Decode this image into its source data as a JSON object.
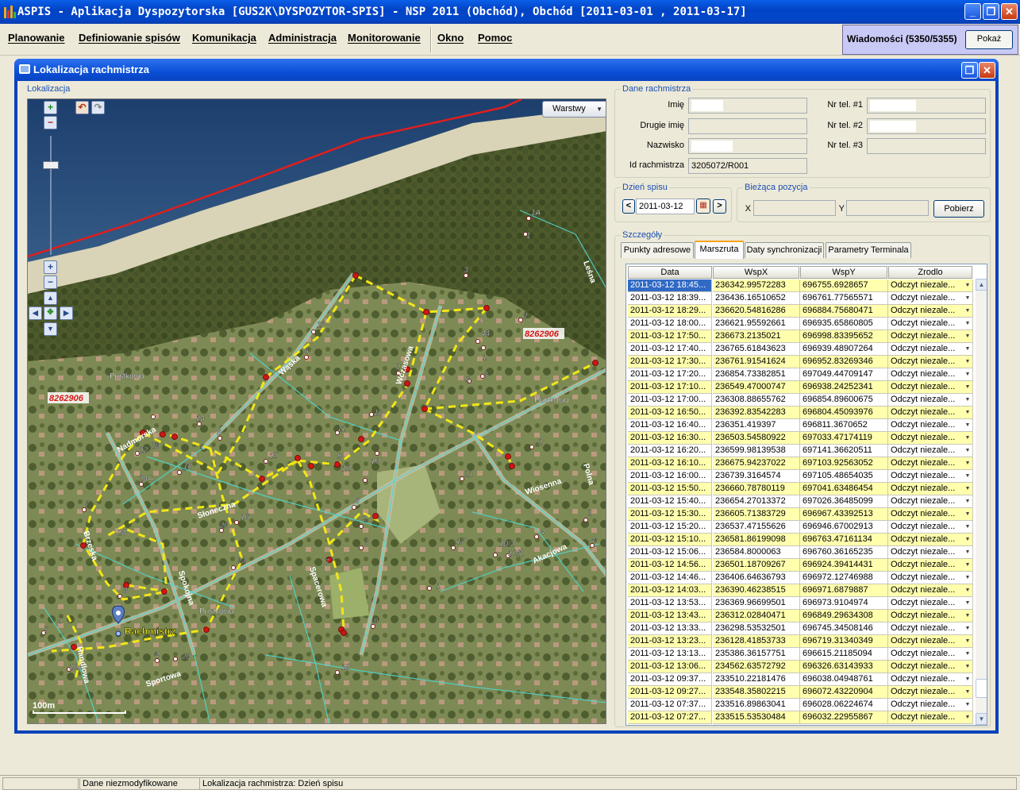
{
  "app": {
    "title": "ASPIS - Aplikacja Dyspozytorska [GUS2K\\DYSPOZYTOR-SPIS] - NSP 2011 (Obchód), Obchód [2011-03-01 , 2011-03-17]"
  },
  "menu": [
    "Planowanie",
    "Definiowanie spisów",
    "Komunikacja",
    "Administracja",
    "Monitorowanie",
    "Okno",
    "Pomoc"
  ],
  "messages": {
    "label": "Wiadomości (5350/5355)",
    "button": "Pokaż"
  },
  "window": {
    "title": "Lokalizacja rachmistrza"
  },
  "map": {
    "group_title": "Lokalizacja",
    "layers_button": "Warstwy",
    "scale_label": "100m",
    "marker_label": "Rachmistrz",
    "region_codes": [
      "8262906",
      "8262906"
    ],
    "place_labels": [
      "Pustkowo",
      "Pustkowo",
      "Pustkowo"
    ],
    "streets": [
      "Leśna",
      "Wąska",
      "Wczasowa",
      "Nadmorska",
      "Słoneczna",
      "Brzeska",
      "Spokojna",
      "Spacerowa",
      "Handlowa",
      "Sportowa",
      "Wiosenna",
      "Polna",
      "Akacjowa"
    ],
    "house_numbers": [
      "1A",
      "1",
      "2",
      "3",
      "44",
      "2",
      "12",
      "6",
      "2",
      "1",
      "3",
      "5",
      "13",
      "2",
      "14",
      "6",
      "11",
      "22",
      "20",
      "18",
      "24A",
      "15",
      "9",
      "12",
      "19",
      "7",
      "21",
      "8",
      "16",
      "20",
      "24",
      "2",
      "23",
      "3",
      "7",
      "4",
      "1",
      "2",
      "4",
      "17",
      "10/2",
      "10/1",
      "6",
      "3",
      "4",
      "20",
      "7",
      "5",
      "10A",
      "10",
      "8",
      "1A",
      "2",
      "4",
      "9",
      "3"
    ]
  },
  "details": {
    "group_title": "Dane rachmistrza",
    "labels": {
      "imie": "Imię",
      "drugie_imie": "Drugie imię",
      "nazwisko": "Nazwisko",
      "id": "Id rachmistrza",
      "tel1": "Nr tel. #1",
      "tel2": "Nr tel. #2",
      "tel3": "Nr tel. #3"
    },
    "id_value": "3205072/R001"
  },
  "census_day": {
    "group_title": "Dzień spisu",
    "date": "2011-03-12",
    "prev": "<",
    "next": ">"
  },
  "position": {
    "group_title": "Bieżąca pozycja",
    "x_label": "X",
    "y_label": "Y",
    "button": "Pobierz"
  },
  "detail_tabs": {
    "group_title": "Szczegóły",
    "tabs": [
      "Punkty adresowe",
      "Marszruta",
      "Daty synchronizacji",
      "Parametry Terminala"
    ]
  },
  "table": {
    "columns": [
      "Data",
      "WspX",
      "WspY",
      "Zrodlo"
    ],
    "rows": [
      [
        "2011-03-12 18:45...",
        "236342.99572283",
        "696755.6928657",
        "Odczyt niezale..."
      ],
      [
        "2011-03-12 18:39...",
        "236436.16510652",
        "696761.77565571",
        "Odczyt niezale..."
      ],
      [
        "2011-03-12 18:29...",
        "236620.54816286",
        "696884.75680471",
        "Odczyt niezale..."
      ],
      [
        "2011-03-12 18:00...",
        "236621.95592661",
        "696935.65860805",
        "Odczyt niezale..."
      ],
      [
        "2011-03-12 17:50...",
        "236673.2135021",
        "696998.83395652",
        "Odczyt niezale..."
      ],
      [
        "2011-03-12 17:40...",
        "236765.61843623",
        "696939.48907264",
        "Odczyt niezale..."
      ],
      [
        "2011-03-12 17:30...",
        "236761.91541624",
        "696952.83269346",
        "Odczyt niezale..."
      ],
      [
        "2011-03-12 17:20...",
        "236854.73382851",
        "697049.44709147",
        "Odczyt niezale..."
      ],
      [
        "2011-03-12 17:10...",
        "236549.47000747",
        "696938.24252341",
        "Odczyt niezale..."
      ],
      [
        "2011-03-12 17:00...",
        "236308.88655762",
        "696854.89600675",
        "Odczyt niezale..."
      ],
      [
        "2011-03-12 16:50...",
        "236392.83542283",
        "696804.45093976",
        "Odczyt niezale..."
      ],
      [
        "2011-03-12 16:40...",
        "236351.419397",
        "696811.3670652",
        "Odczyt niezale..."
      ],
      [
        "2011-03-12 16:30...",
        "236503.54580922",
        "697033.47174119",
        "Odczyt niezale..."
      ],
      [
        "2011-03-12 16:20...",
        "236599.98139538",
        "697141.36620511",
        "Odczyt niezale..."
      ],
      [
        "2011-03-12 16:10...",
        "236675.94237022",
        "697103.92563052",
        "Odczyt niezale..."
      ],
      [
        "2011-03-12 16:00...",
        "236739.3164574",
        "697105.48654035",
        "Odczyt niezale..."
      ],
      [
        "2011-03-12 15:50...",
        "236660.78780119",
        "697041.63486454",
        "Odczyt niezale..."
      ],
      [
        "2011-03-12 15:40...",
        "236654.27013372",
        "697026.36485099",
        "Odczyt niezale..."
      ],
      [
        "2011-03-12 15:30...",
        "236605.71383729",
        "696967.43392513",
        "Odczyt niezale..."
      ],
      [
        "2011-03-12 15:20...",
        "236537.47155626",
        "696946.67002913",
        "Odczyt niezale..."
      ],
      [
        "2011-03-12 15:10...",
        "236581.86199098",
        "696763.47161134",
        "Odczyt niezale..."
      ],
      [
        "2011-03-12 15:06...",
        "236584.8000063",
        "696760.36165235",
        "Odczyt niezale..."
      ],
      [
        "2011-03-12 14:56...",
        "236501.18709267",
        "696924.39414431",
        "Odczyt niezale..."
      ],
      [
        "2011-03-12 14:46...",
        "236406.64636793",
        "696972.12746988",
        "Odczyt niezale..."
      ],
      [
        "2011-03-12 14:03...",
        "236390.46238515",
        "696971.6879887",
        "Odczyt niezale..."
      ],
      [
        "2011-03-12 13:53...",
        "236369.96699501",
        "696973.9104974",
        "Odczyt niezale..."
      ],
      [
        "2011-03-12 13:43...",
        "236312.02840471",
        "696849.29634308",
        "Odczyt niezale..."
      ],
      [
        "2011-03-12 13:33...",
        "236298.53532501",
        "696745.34508146",
        "Odczyt niezale..."
      ],
      [
        "2011-03-12 13:23...",
        "236128.41853733",
        "696719.31340349",
        "Odczyt niezale..."
      ],
      [
        "2011-03-12 13:13...",
        "235386.36157751",
        "696615.21185094",
        "Odczyt niezale..."
      ],
      [
        "2011-03-12 13:06...",
        "234562.63572792",
        "696326.63143933",
        "Odczyt niezale..."
      ],
      [
        "2011-03-12 09:37...",
        "233510.22181476",
        "696038.04948761",
        "Odczyt niezale..."
      ],
      [
        "2011-03-12 09:27...",
        "233548.35802215",
        "696072.43220904",
        "Odczyt niezale..."
      ],
      [
        "2011-03-12 07:37...",
        "233516.89863041",
        "696028.06224674",
        "Odczyt niezale..."
      ],
      [
        "2011-03-12 07:27...",
        "233515.53530484",
        "696032.22955867",
        "Odczyt niezale..."
      ]
    ]
  },
  "statusbar": [
    "Dane niezmodyfikowane",
    "Lokalizacja rachmistrza: Dzień spisu"
  ]
}
